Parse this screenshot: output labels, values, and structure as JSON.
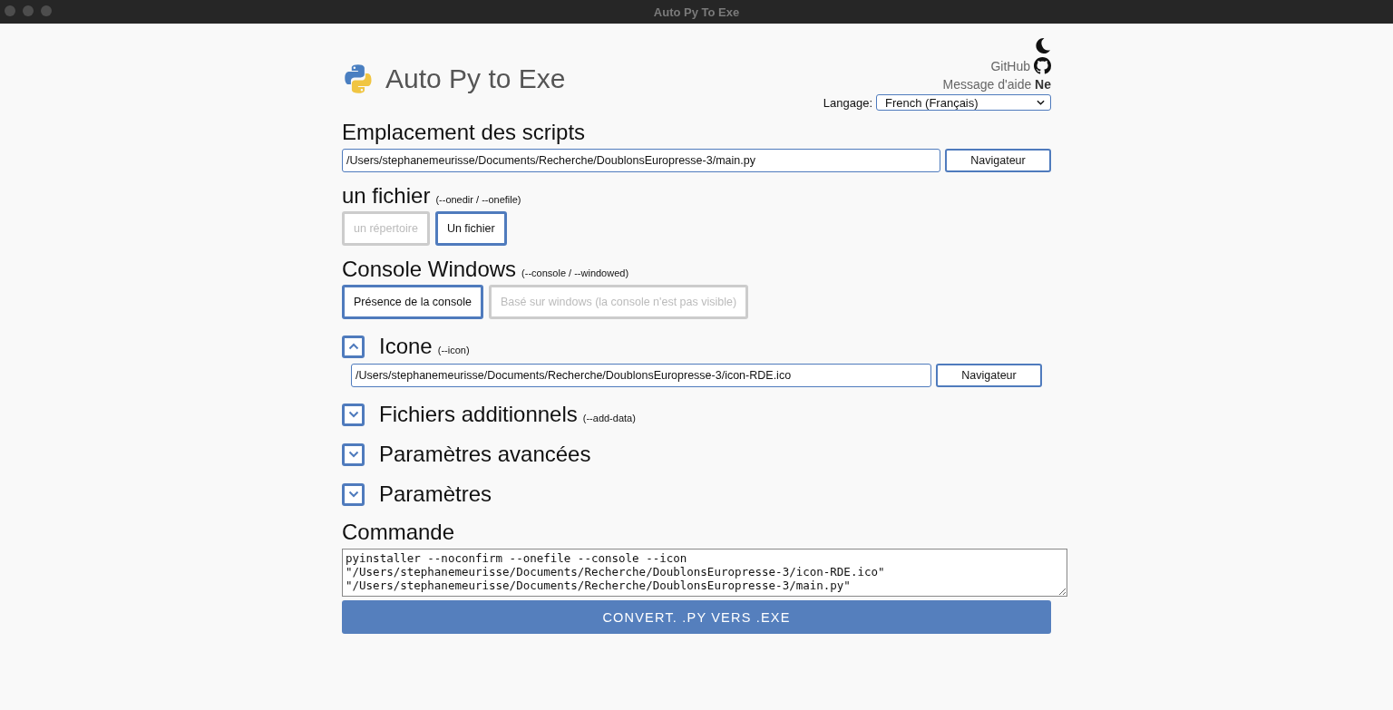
{
  "window": {
    "title": "Auto Py To Exe"
  },
  "header": {
    "title": "Auto Py to Exe",
    "github": "GitHub",
    "help": "Message d'aide **Ne**",
    "language_label": "Langage:",
    "language": "French (Français)"
  },
  "script_location": {
    "title": "Emplacement des scripts",
    "path": "/Users/stephanemeurisse/Documents/Recherche/DoublonsEuropresse-3/main.py",
    "button": "Navigateur"
  },
  "option_groups": [
    {
      "title": "un fichier",
      "flag": "(--onedir / --onefile)",
      "options": [
        {
          "label": "un répertoire",
          "selected": false
        },
        {
          "label": "Un fichier",
          "selected": true
        }
      ]
    },
    {
      "title": "Console Windows",
      "flag": "(--console / --windowed)",
      "options": [
        {
          "label": "Présence de la console",
          "selected": true
        },
        {
          "label": "Basé sur windows (la console n'est pas visible)",
          "selected": false
        }
      ]
    }
  ],
  "sections": [
    {
      "title": "Icone",
      "flag": "(--icon)",
      "expanded": true,
      "path": "/Users/stephanemeurisse/Documents/Recherche/DoublonsEuropresse-3/icon-RDE.ico",
      "button": "Navigateur"
    },
    {
      "title": "Fichiers additionnels",
      "flag": "(--add-data)",
      "expanded": false
    },
    {
      "title": "Paramètres avancées",
      "expanded": false
    },
    {
      "title": "Paramètres",
      "expanded": false
    }
  ],
  "command": {
    "title": "Commande",
    "text": "pyinstaller --noconfirm --onefile --console --icon \"/Users/stephanemeurisse/Documents/Recherche/DoublonsEuropresse-3/icon-RDE.ico\" \"/Users/stephanemeurisse/Documents/Recherche/DoublonsEuropresse-3/main.py\""
  },
  "convert_button": "CONVERT. .PY VERS .EXE"
}
